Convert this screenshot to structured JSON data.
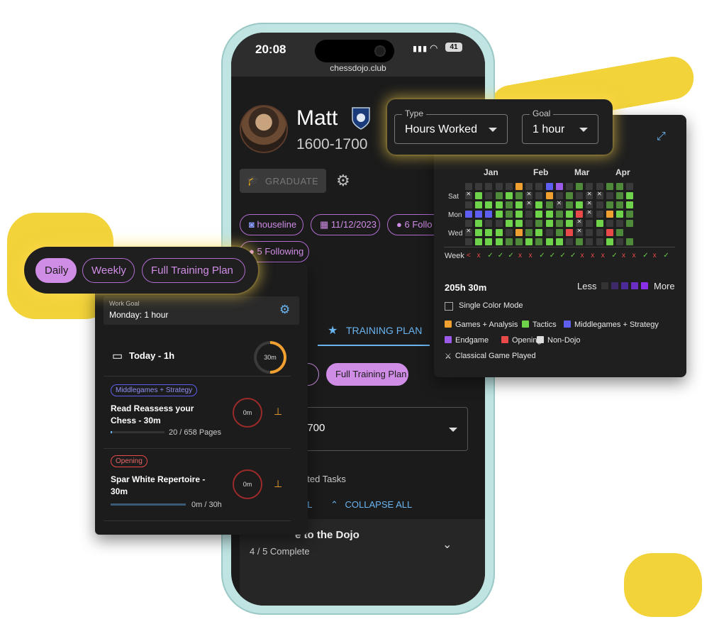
{
  "statusbar": {
    "time": "20:08",
    "signal": "▮▮▮",
    "wifi": "◠",
    "battery": "41",
    "url": "chessdojo.club"
  },
  "profile": {
    "name": "Matt",
    "rating_range": "1600-1700",
    "graduate_label": "GRADUATE",
    "discord": "houseline",
    "joined": "11/12/2023",
    "followers": "6 Follo",
    "following": "5 Following"
  },
  "tabs": {
    "training_plan": "TRAINING PLAN"
  },
  "phone_bg": {
    "plan_chip_partial": "y",
    "plan_chip_full": "Full Training Plan",
    "cohort_select": "1700",
    "hide_completed": "eted Tasks",
    "expand_partial": "LL",
    "collapse_all": "COLLAPSE ALL",
    "section_title": "e to the Dojo",
    "section_progress": "4 / 5 Complete"
  },
  "heatmap": {
    "type_label": "Type",
    "type_value": "Hours Worked",
    "goal_label": "Goal",
    "goal_value": "1 hour",
    "months": [
      "Jan",
      "Feb",
      "Mar",
      "Apr"
    ],
    "days": [
      "Sat",
      "Mon",
      "Wed"
    ],
    "week_label": "Week",
    "total": "205h 30m",
    "less": "Less",
    "more": "More",
    "single_color_mode": "Single Color Mode",
    "legend": [
      {
        "label": "Games + Analysis",
        "color": "#f0a030"
      },
      {
        "label": "Tactics",
        "color": "#6ed34a"
      },
      {
        "label": "Middlegames + Strategy",
        "color": "#5e5ef0"
      },
      {
        "label": "Endgame",
        "color": "#9b5ae8"
      },
      {
        "label": "Opening",
        "color": "#e84a4a"
      },
      {
        "label": "Non-Dojo",
        "color": "#dddddd"
      },
      {
        "label": "Classical Game Played",
        "color": ""
      }
    ],
    "colors": {
      "empty": "#3a3a3a",
      "dark_green": "#4e8a3a",
      "scale": [
        "#333333",
        "#3d2a6b",
        "#4d2a9a",
        "#6a2ec4",
        "#8a2ee8"
      ]
    }
  },
  "plan_tabs": [
    "Daily",
    "Weekly",
    "Full Training Plan"
  ],
  "daily": {
    "work_goal_label": "Work Goal",
    "work_goal_value": "Monday: 1 hour",
    "today_label": "Today - 1h",
    "today_time": "30m",
    "today_progress": 0.5,
    "tasks": [
      {
        "tag": "Middlegames + Strategy",
        "title_1": "Read Reassess your",
        "title_2": "Chess - 30m",
        "time": "0m",
        "progress_text": "20 / 658 Pages",
        "progress": 0.03
      },
      {
        "tag": "Opening",
        "title_1": "Spar White Repertoire -",
        "title_2": "30m",
        "time": "0m",
        "progress_text": "0m / 30h",
        "progress": 0.0
      }
    ]
  }
}
